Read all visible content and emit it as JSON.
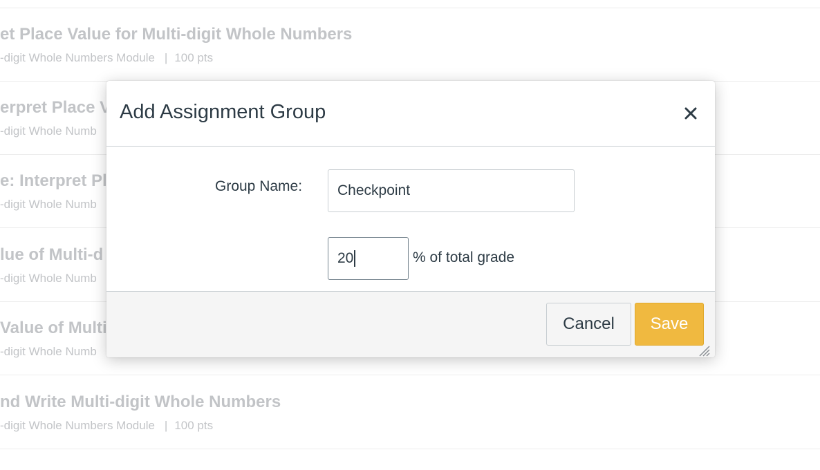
{
  "background_list": {
    "rows": [
      {
        "title": "et Place Value for Multi-digit Whole Numbers",
        "module": "-digit Whole Numbers Module",
        "points": "100 pts"
      },
      {
        "title": "erpret Place V",
        "module": "-digit Whole Numb",
        "points": ""
      },
      {
        "title": "e: Interpret Pl",
        "module": "-digit Whole Numb",
        "points": ""
      },
      {
        "title": "lue of Multi-d",
        "module": "-digit Whole Numb",
        "points": ""
      },
      {
        "title": "Value of Multi-",
        "module": "-digit Whole Numb",
        "points": ""
      },
      {
        "title": "nd Write Multi-digit Whole Numbers",
        "module": "-digit Whole Numbers Module",
        "points": "100 pts"
      }
    ]
  },
  "dialog": {
    "title": "Add Assignment Group",
    "close_icon": "close-icon",
    "group_name_label": "Group Name:",
    "group_name_value": "Checkpoint",
    "percent_value": "20",
    "percent_suffix": "% of total grade",
    "cancel_label": "Cancel",
    "save_label": "Save",
    "resize_icon": "resize-handle-icon"
  },
  "colors": {
    "save_button": "#f0b940",
    "text_primary": "#2d3b45",
    "muted_text": "#c2c4c7",
    "footer_bg": "#f5f5f5"
  }
}
